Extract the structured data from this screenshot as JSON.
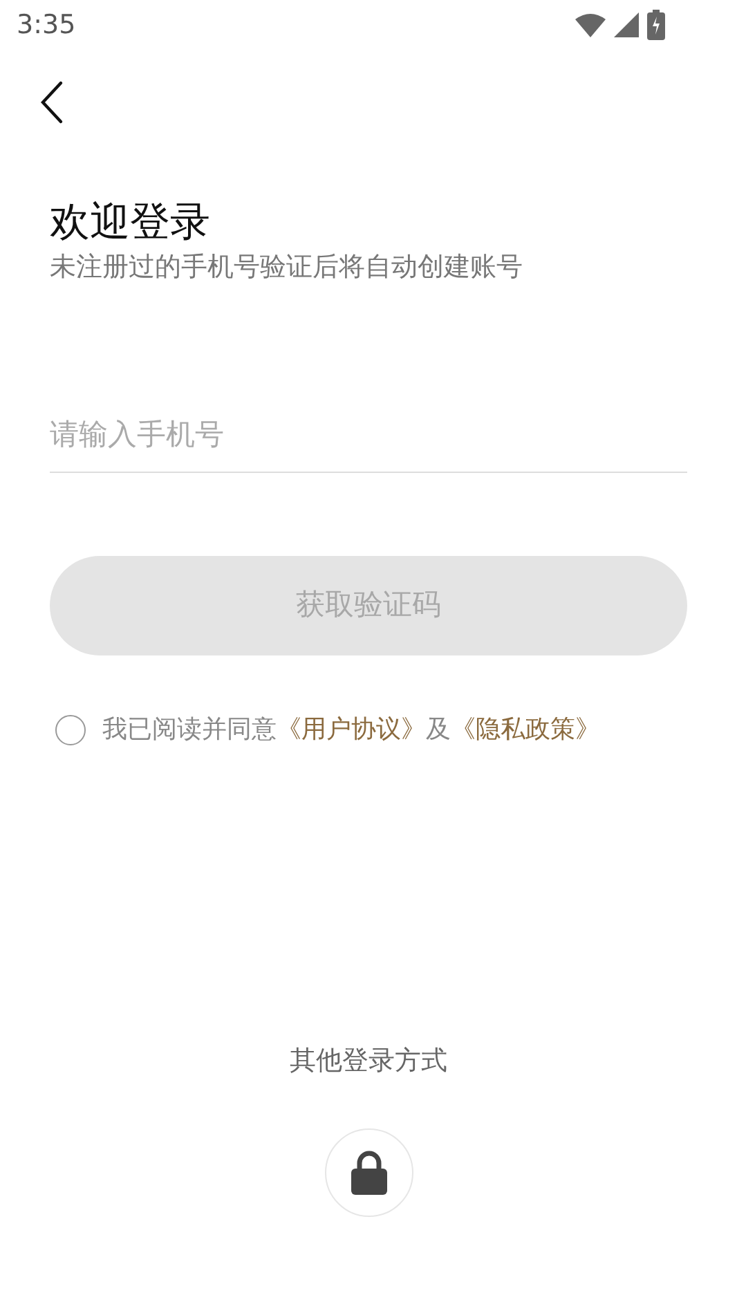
{
  "status_bar": {
    "time": "3:35"
  },
  "header": {
    "title": "欢迎登录",
    "subtitle": "未注册过的手机号验证后将自动创建账号"
  },
  "phone_field": {
    "placeholder": "请输入手机号"
  },
  "code_button": {
    "label": "获取验证码",
    "disabled": true
  },
  "agreement": {
    "checked": false,
    "text": "我已阅读并同意",
    "links": [
      "《用户协议》",
      "《隐私政策》"
    ],
    "joiner": "及"
  },
  "other_login": {
    "label": "其他登录方式"
  }
}
